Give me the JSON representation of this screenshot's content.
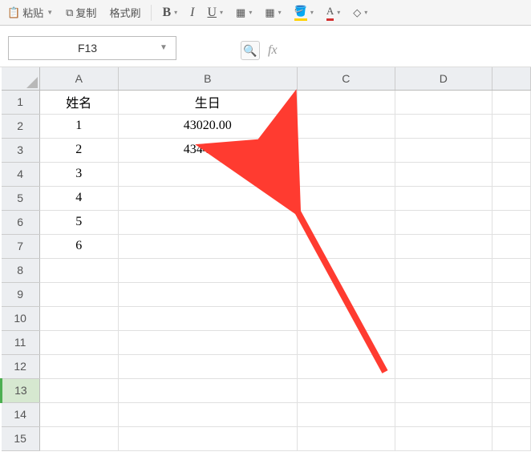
{
  "toolbar": {
    "paste": "粘贴",
    "copy": "复制",
    "format_painter": "格式刷",
    "bold": "B",
    "italic": "I",
    "underline": "U"
  },
  "namebox": {
    "value": "F13"
  },
  "formula_bar": {
    "fx": "fx"
  },
  "columns": [
    "A",
    "B",
    "C",
    "D",
    ""
  ],
  "rows": [
    "1",
    "2",
    "3",
    "4",
    "5",
    "6",
    "7",
    "8",
    "9",
    "10",
    "11",
    "12",
    "13",
    "14",
    "15"
  ],
  "selected_row": "13",
  "cells": {
    "A1": "姓名",
    "B1": "生日",
    "A2": "1",
    "B2": "43020.00",
    "A3": "2",
    "B3": "43444.00",
    "A4": "3",
    "A5": "4",
    "A6": "5",
    "A7": "6"
  }
}
